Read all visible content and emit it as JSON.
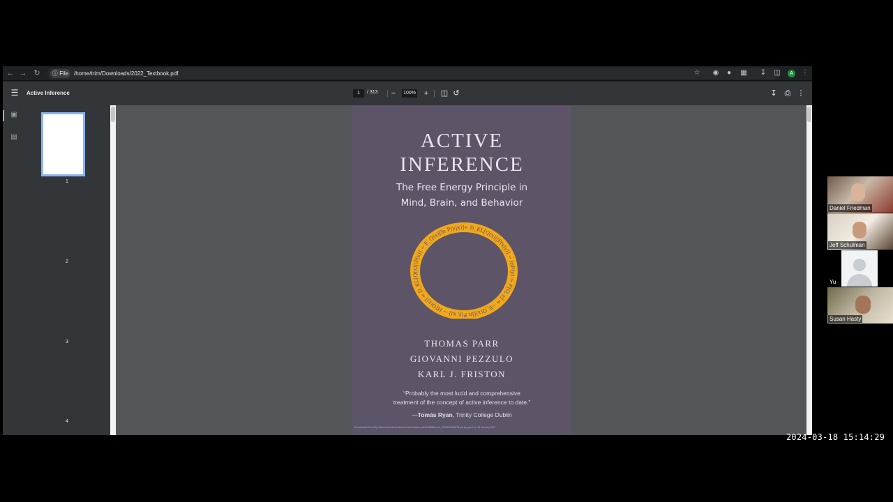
{
  "browser": {
    "site_chip": "File",
    "url": "/home/trim/Downloads/2022_Textbook.pdf",
    "profile_initial": "A"
  },
  "pdf_toolbar": {
    "title": "Active Inference",
    "current_page": "1",
    "page_total": "/ 313",
    "zoom": "100%"
  },
  "thumbnails": {
    "pages": [
      "1",
      "2",
      "3",
      "4"
    ]
  },
  "cover": {
    "title_line1": "ACTIVE",
    "title_line2": "INFERENCE",
    "subtitle_line1": "The Free Energy Principle in",
    "subtitle_line2": "Mind, Brain, and Behavior",
    "ring_formula": "= D_KL[Q(x)||P(x|y)] − lnP(y) = F[Q, y] = −E_Q(x)[ln P(y, x)] − H[Q(x)] = D_KL[Q(x)||P(x)] − E_Q(x)[ln P(y|x)]",
    "ring_color": "#f0a81c",
    "background_color": "#5e5468",
    "authors": [
      "THOMAS PARR",
      "GIOVANNI PEZZULO",
      "KARL J. FRISTON"
    ],
    "quote_line1": "“Probably the most lucid and comprehensive",
    "quote_line2": "treatment of the concept of active inference to date.”",
    "quote_dash": "—",
    "quote_name": "Tomás Ryan",
    "quote_affiliation": ", Trinity College Dublin",
    "footer_link": "Downloaded from http://direct.mit.edu/books/oa-book/chapter-pdf/2246566/book_9780262369978.pdf by guest on 15 January 2024"
  },
  "participants": [
    {
      "name": "Daniel Friedman"
    },
    {
      "name": "Jeff Schulman"
    },
    {
      "name": "Yu"
    },
    {
      "name": "Susan Hasty"
    }
  ],
  "timestamp": "2024-03-18 15:14:29"
}
